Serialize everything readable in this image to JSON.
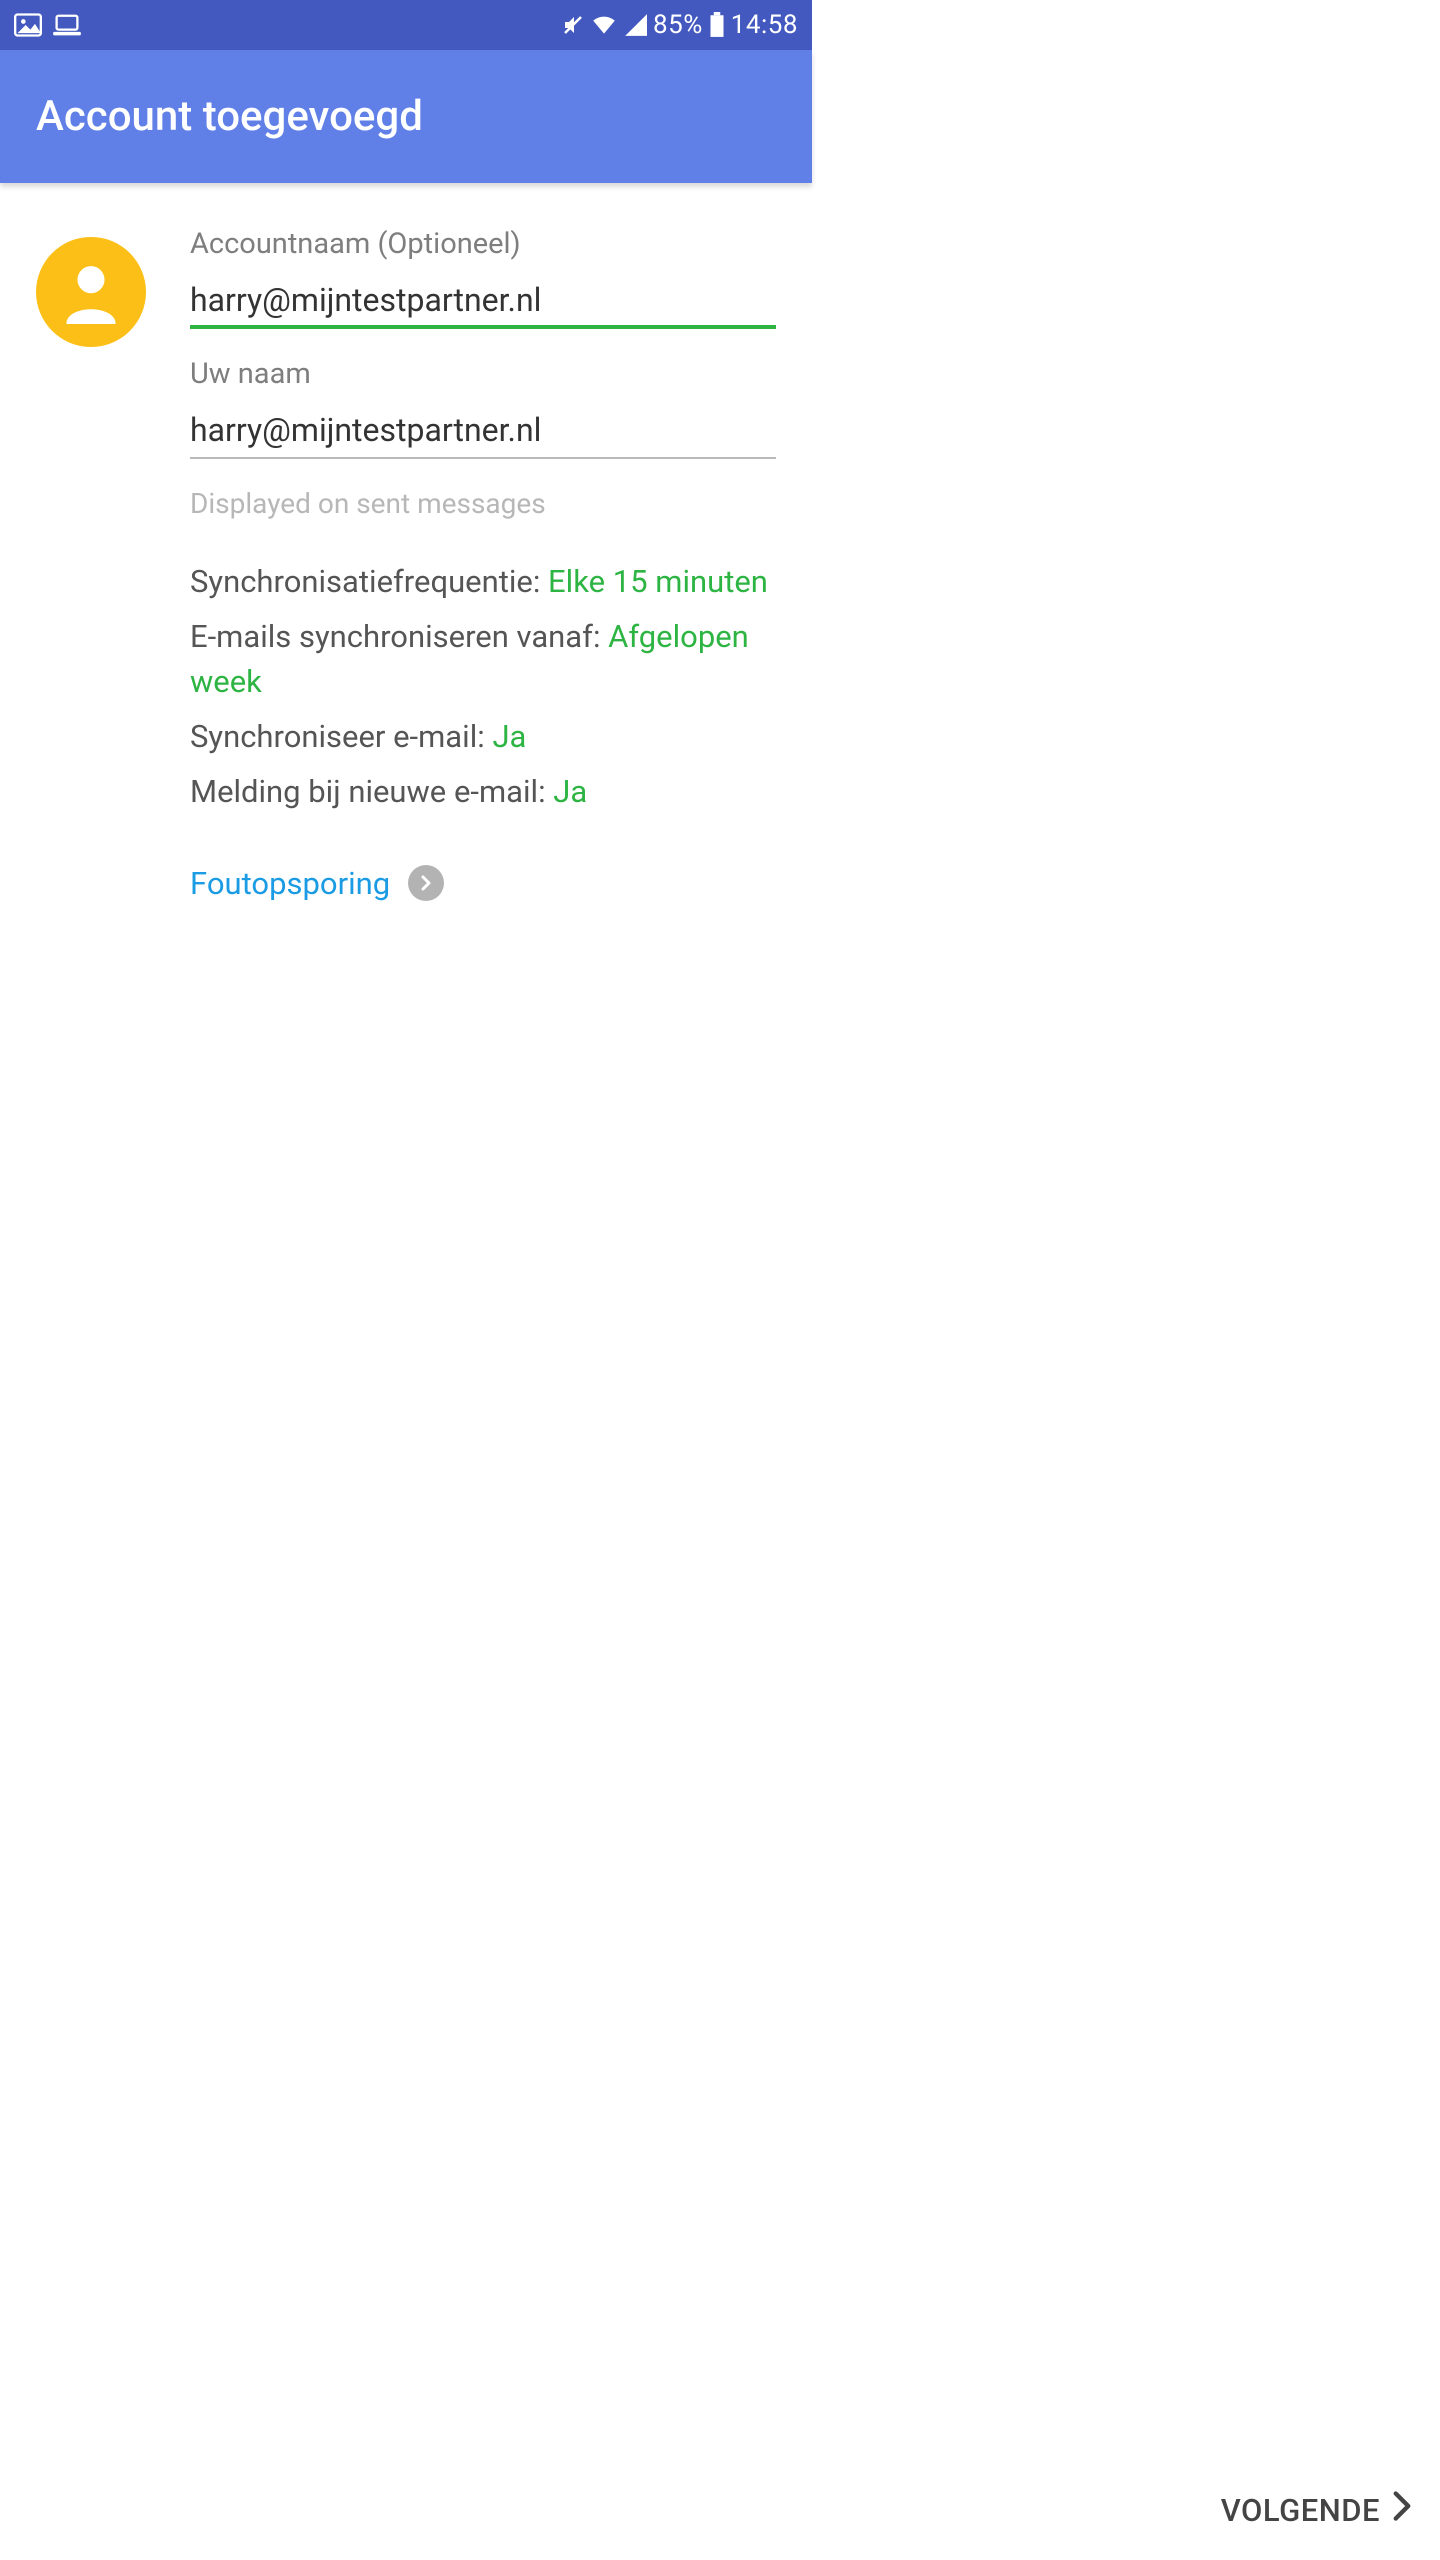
{
  "status": {
    "battery_pct": "85%",
    "time": "14:58"
  },
  "header": {
    "title": "Account toegevoegd"
  },
  "form": {
    "account_name_label": "Accountnaam (Optioneel)",
    "account_name_value": "harry@mijntestpartner.nl",
    "your_name_label": "Uw naam",
    "your_name_value": "harry@mijntestpartner.nl",
    "helper": "Displayed on sent messages"
  },
  "settings": {
    "sync_freq_label": "Synchronisatiefrequentie: ",
    "sync_freq_value": "Elke 15 minuten",
    "sync_from_label": "E-mails synchroniseren vanaf: ",
    "sync_from_value": "Afgelopen week",
    "sync_mail_label": "Synchroniseer e-mail: ",
    "sync_mail_value": "Ja",
    "notify_label": "Melding bij nieuwe e-mail: ",
    "notify_value": "Ja"
  },
  "debug": {
    "label": "Foutopsporing"
  },
  "footer": {
    "next": "VOLGENDE"
  }
}
